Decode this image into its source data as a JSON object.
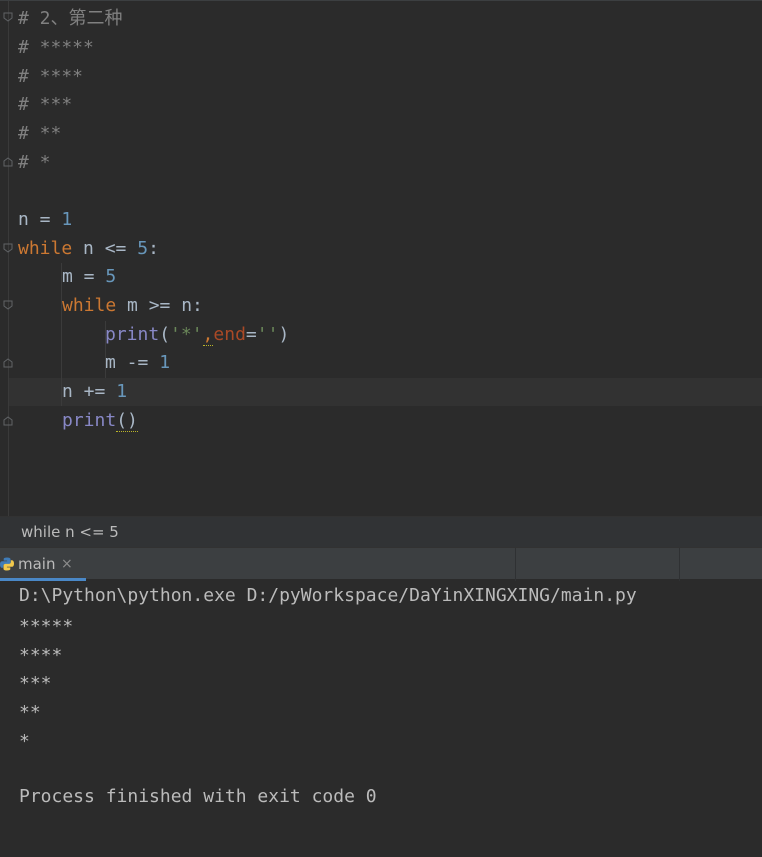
{
  "editor": {
    "lines": {
      "comment_title": "# 2、第二种",
      "comment_1": "# *****",
      "comment_2": "# ****",
      "comment_3": "# ***",
      "comment_4": "# **",
      "comment_5": "# *",
      "n_var": "n",
      "eq": " = ",
      "one": "1",
      "kw_while": "while",
      "cond_outer": " n <= ",
      "five": "5",
      "colon": ":",
      "m_assign": "m = ",
      "cond_inner": " m >= n:",
      "print_fn": "print",
      "print_args_open": "(",
      "star_str": "'*'",
      "comma": ",",
      "end_kw": "end",
      "end_eq": "=",
      "empty_str": "''",
      "print_args_close": ")",
      "m_dec": "m -= ",
      "n_inc": "n += ",
      "print_empty": "()"
    }
  },
  "breadcrumb": {
    "text": "while n <= 5"
  },
  "run_panel": {
    "tab_label": "main",
    "close_glyph": "×",
    "output": [
      "D:\\Python\\python.exe D:/pyWorkspace/DaYinXINGXING/main.py",
      "*****",
      "****",
      "***",
      "**",
      "*",
      "",
      "Process finished with exit code 0"
    ]
  },
  "colors": {
    "background": "#2b2b2b",
    "keyword": "#cc7832",
    "number": "#6897bb",
    "builtin": "#8888c6",
    "string": "#6a8759",
    "comment": "#808080",
    "tab_accent": "#4a88c7"
  },
  "icons": {
    "tab_icon": "python-icon",
    "fold": "fold-marker-icon"
  }
}
